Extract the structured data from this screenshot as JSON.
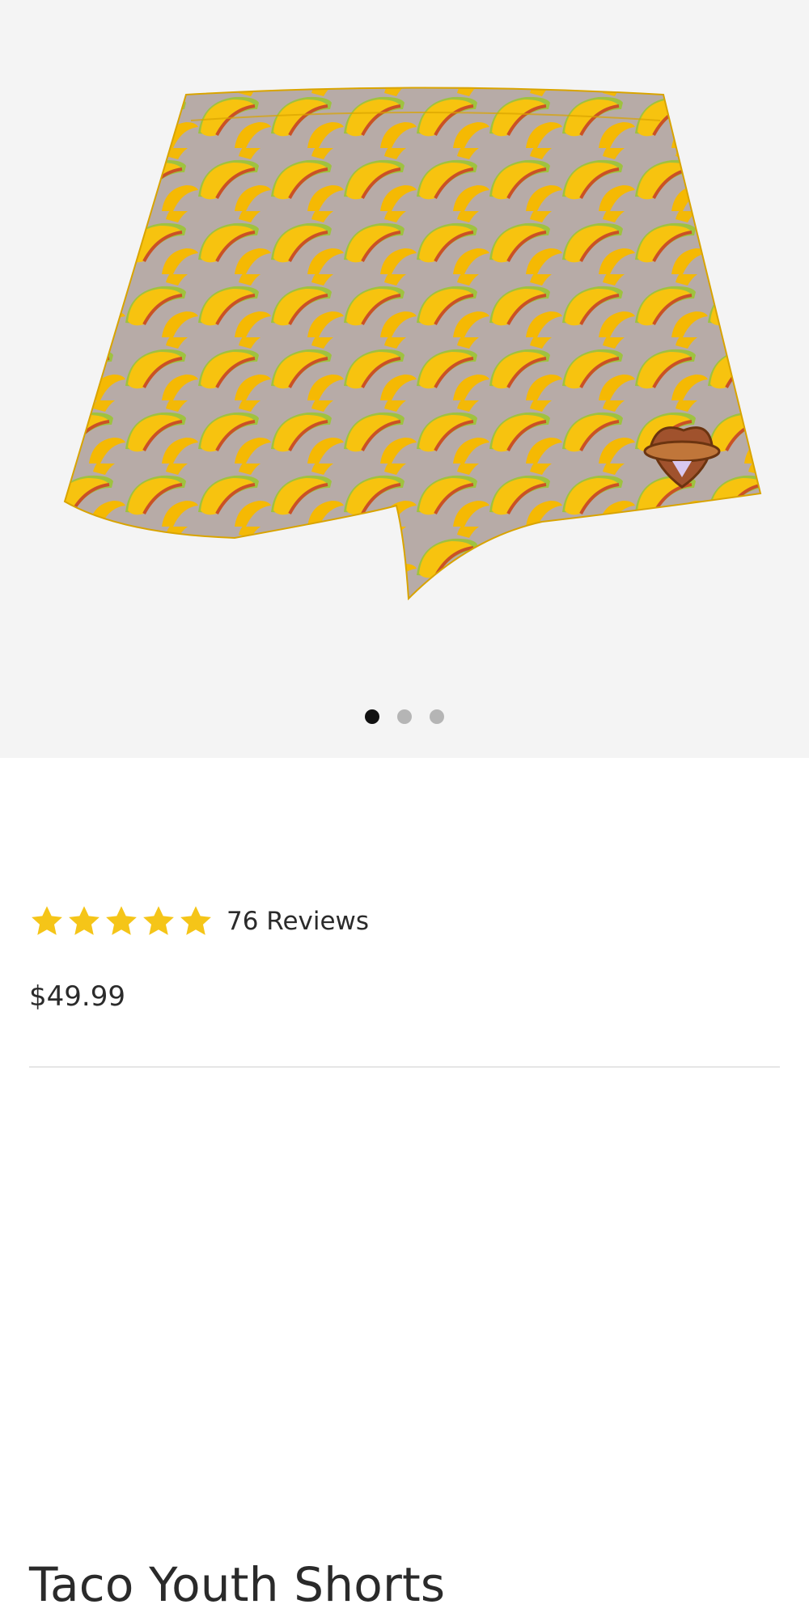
{
  "gallery": {
    "image_alt": "Taco Youth Shorts product image",
    "dots": [
      {
        "active": true
      },
      {
        "active": false
      },
      {
        "active": false
      }
    ]
  },
  "product": {
    "title": "Taco Youth Shorts",
    "rating": 5,
    "rating_max": 5,
    "reviews_label": "76 Reviews",
    "price": "$49.99"
  },
  "colors": {
    "star": "#F5C518",
    "short_yellow": "#F7C40F",
    "short_bg_purple": "#A9A6C8"
  }
}
